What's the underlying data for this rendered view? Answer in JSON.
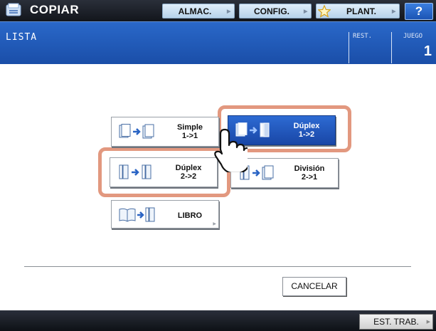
{
  "header": {
    "app_title": "COPIAR",
    "buttons": [
      {
        "label": "ALMAC."
      },
      {
        "label": "CONFIG."
      },
      {
        "label": "PLANT.",
        "icon": "star-icon"
      }
    ],
    "help_label": "?"
  },
  "status": {
    "title": "LISTA",
    "rest_label": "REST.",
    "juego_label": "JUEGO",
    "juego_value": "1"
  },
  "options": {
    "simple": {
      "line1": "Simple",
      "line2": "1->1"
    },
    "duplex_1_2": {
      "line1": "Dúplex",
      "line2": "1->2",
      "selected": true
    },
    "duplex_2_2": {
      "line1": "Dúplex",
      "line2": "2->2"
    },
    "division": {
      "line1": "División",
      "line2": "2->1"
    },
    "libro": {
      "label": "LIBRO"
    }
  },
  "actions": {
    "cancel_label": "CANCELAR"
  },
  "footer": {
    "est_trab_label": "EST. TRAB."
  },
  "colors": {
    "accent_blue": "#1f57b8",
    "highlight": "#e2987f",
    "top_bar": "#1a1d24"
  }
}
